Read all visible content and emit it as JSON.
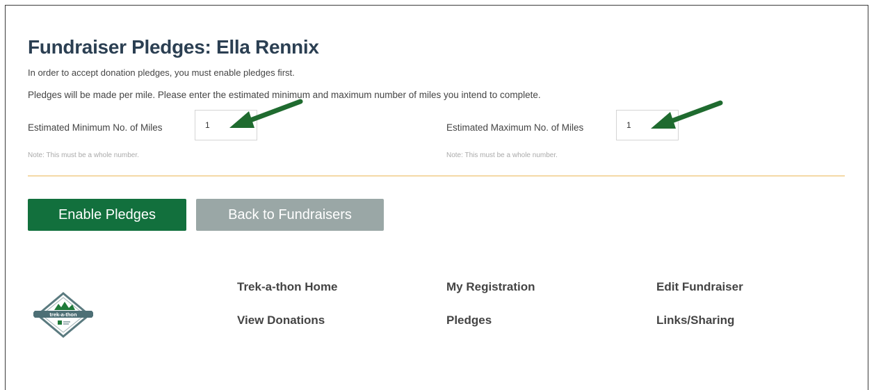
{
  "page": {
    "title": "Fundraiser Pledges: Ella Rennix",
    "intro_line1": "In order to accept donation pledges, you must enable pledges first.",
    "intro_line2": "Pledges will be made per mile. Please enter the estimated minimum and maximum number of miles you intend to complete."
  },
  "form": {
    "min_miles": {
      "label": "Estimated Minimum No. of Miles",
      "value": "1",
      "note": "Note: This must be a whole number."
    },
    "max_miles": {
      "label": "Estimated Maximum No. of Miles",
      "value": "1",
      "note": "Note: This must be a whole number."
    }
  },
  "actions": {
    "enable_label": "Enable Pledges",
    "back_label": "Back to Fundraisers"
  },
  "footer": {
    "logo_icon": "trek-a-thon-logo",
    "logo_text": "trek-a-thon",
    "links": [
      "Trek-a-thon Home",
      "My Registration",
      "Edit Fundraiser",
      "View Donations",
      "Pledges",
      "Links/Sharing"
    ]
  },
  "colors": {
    "primary": "#12703d",
    "secondary": "#9aa7a6",
    "title": "#2b3f52",
    "divider": "#f4d9a6",
    "arrow": "#1f6b2f"
  }
}
